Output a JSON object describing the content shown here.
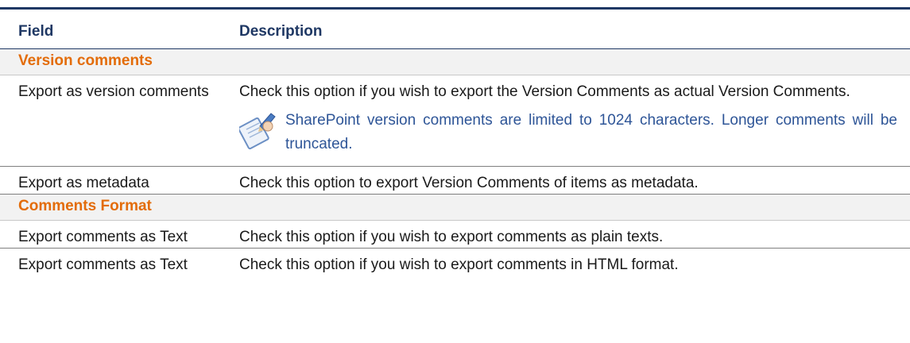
{
  "table": {
    "headers": {
      "field": "Field",
      "description": "Description"
    },
    "sections": [
      {
        "title": "Version comments",
        "rows": [
          {
            "field": "Export as version comments",
            "description": "Check this option if you wish to export the Version Comments as actual Version Comments.",
            "note": "SharePoint version comments are limited to 1024 characters. Longer comments will be truncated."
          },
          {
            "field": "Export as metadata",
            "description": "Check this option to export Version Comments of items as metadata."
          }
        ]
      },
      {
        "title": "Comments Format",
        "rows": [
          {
            "field": "Export comments as Text",
            "description": "Check this option if you wish to export comments as plain texts."
          },
          {
            "field": "Export comments as Text",
            "description": "Check this option if you wish to export comments in HTML format."
          }
        ]
      }
    ]
  },
  "icons": {
    "note": "note-pen-icon"
  },
  "colors": {
    "header_text": "#1f3864",
    "section_text": "#e36c09",
    "note_text": "#2e5597",
    "rule": "#1f3864"
  }
}
